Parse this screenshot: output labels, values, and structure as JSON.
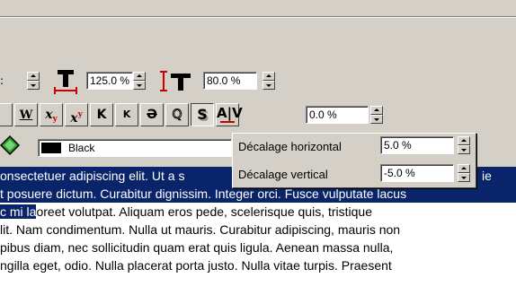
{
  "row1": {
    "font_size_prefix": ":",
    "horizontal_scale": "125.0 %",
    "vertical_scale": "80.0 %"
  },
  "row2": {
    "buttons": [
      "W",
      "x",
      "x",
      "K",
      "K",
      "Ə",
      "Q",
      "S",
      "A|V"
    ],
    "tracking": "0.0 %"
  },
  "row3": {
    "color_name": "Black"
  },
  "popup": {
    "horizontal_label": "Décalage horizontal",
    "horizontal_value": "5.0 %",
    "vertical_label": "Décalage vertical",
    "vertical_value": "-5.0 %"
  },
  "text": {
    "line1_sel_a": "onsectetuer adipiscing elit. Ut a s",
    "line1_sel_b": "ie",
    "line2_sel": "t posuere dictum. Curabitur dignissim. Integer orci. Fusce vulputate lacus",
    "line3_sel": "c mi la",
    "line3_rest": "oreet volutpat. Aliquam eros pede, scelerisque quis, tristique",
    "line4": "lit. Nam condimentum. Nulla ut mauris. Curabitur adipiscing, mauris non",
    "line5": "pibus diam, nec sollicitudin quam erat quis ligula. Aenean massa nulla,",
    "line6": "ngilla eget, odio. Nulla placerat porta justo. Nulla vitae turpis. Praesent"
  },
  "colors": {
    "selection": "#0a246a",
    "scale_icon": "#cc0000"
  }
}
